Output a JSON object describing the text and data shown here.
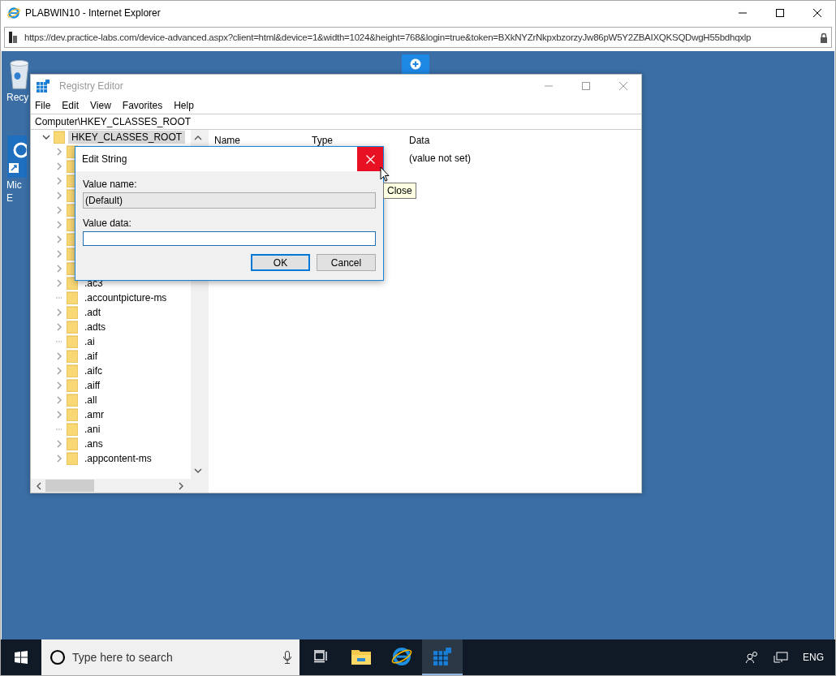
{
  "browser": {
    "title": "PLABWIN10 - Internet Explorer",
    "url": "https://dev.practice-labs.com/device-advanced.aspx?client=html&device=1&width=1024&height=768&login=true&token=BXkNYZrNkpxbzorzyJw86pW5Y2ZBAIXQKSQDwgH55bdhqxlp"
  },
  "desktop_icons": [
    {
      "kind": "recycle",
      "label": "Recy"
    },
    {
      "kind": "edge",
      "label": "Mic",
      "label_2": "E"
    }
  ],
  "regedit": {
    "title": "Registry Editor",
    "menu": [
      "File",
      "Edit",
      "View",
      "Favorites",
      "Help"
    ],
    "address": "Computer\\HKEY_CLASSES_ROOT",
    "tree": {
      "label": "HKEY_CLASSES_ROOT",
      "expanded": true,
      "selected": true,
      "children": [
        {
          "expandable": true
        },
        {
          "expandable": true
        },
        {
          "expandable": true
        },
        {
          "expandable": true
        },
        {
          "expandable": true
        },
        {
          "expandable": true
        },
        {
          "expandable": true
        },
        {
          "expandable": true
        },
        {
          "expandable": true
        },
        {
          "label": ".ac3",
          "expandable": true
        },
        {
          "label": ".accountpicture-ms",
          "expandable": false
        },
        {
          "label": ".adt",
          "expandable": true
        },
        {
          "label": ".adts",
          "expandable": true
        },
        {
          "label": ".ai",
          "expandable": false
        },
        {
          "label": ".aif",
          "expandable": true
        },
        {
          "label": ".aifc",
          "expandable": true
        },
        {
          "label": ".aiff",
          "expandable": true
        },
        {
          "label": ".all",
          "expandable": true
        },
        {
          "label": ".amr",
          "expandable": true
        },
        {
          "label": ".ani",
          "expandable": false
        },
        {
          "label": ".ans",
          "expandable": true
        },
        {
          "label": ".appcontent-ms",
          "expandable": true
        }
      ]
    },
    "columns": [
      "Name",
      "Type",
      "Data"
    ],
    "rows": [
      {
        "data": "(value not set)"
      }
    ]
  },
  "dialog": {
    "title": "Edit String",
    "value_name_label": "Value name:",
    "value_name": "(Default)",
    "value_data_label": "Value data:",
    "buttons": [
      {
        "label": "OK",
        "default": true
      },
      {
        "label": "Cancel",
        "default": false
      }
    ]
  },
  "tooltip": "Close",
  "taskbar": {
    "search_placeholder": "Type here to search",
    "apps": [
      {
        "kind": "taskview",
        "active": false
      },
      {
        "kind": "explorer",
        "active": false
      },
      {
        "kind": "ie",
        "active": false
      },
      {
        "kind": "regedit",
        "active": true
      }
    ],
    "language": "ENG"
  }
}
